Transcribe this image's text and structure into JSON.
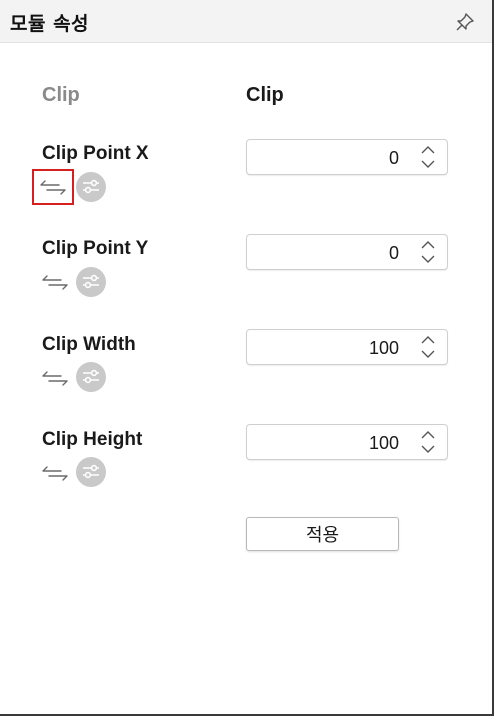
{
  "panel": {
    "title": "모듈 속성",
    "pin_icon": "pin-icon"
  },
  "columns": {
    "left_header": "Clip",
    "right_header": "Clip"
  },
  "properties": [
    {
      "label": "Clip Point X",
      "value": "0"
    },
    {
      "label": "Clip Point Y",
      "value": "0"
    },
    {
      "label": "Clip Width",
      "value": "100"
    },
    {
      "label": "Clip Height",
      "value": "100"
    }
  ],
  "icons": {
    "link": "link-arrows-icon",
    "settings": "sliders-icon",
    "spin_up": "chevron-up-icon",
    "spin_down": "chevron-down-icon"
  },
  "apply_button": {
    "label": "적용"
  },
  "colors": {
    "selection_outline": "#d61f1f",
    "settings_circle": "#c9c9c9",
    "muted_header": "#8a8a8a"
  }
}
